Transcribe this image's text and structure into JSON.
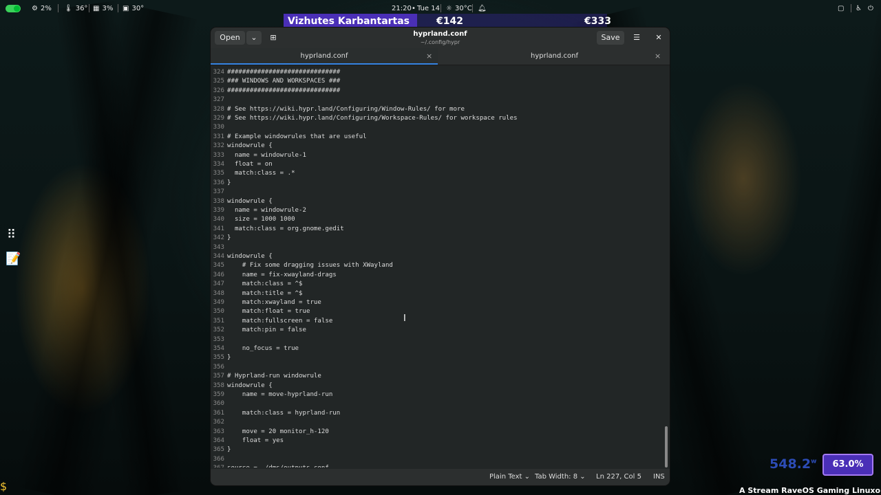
{
  "topbar": {
    "cpu": "2%",
    "temp1": "36°",
    "ram": "3%",
    "temp2": "30°",
    "time": "21:20",
    "date": "Tue 14",
    "weather": "30°C"
  },
  "hud": {
    "name": "Vizhutes Karbantartas",
    "value1": "€142",
    "value2": "€333"
  },
  "editor_window": {
    "open_label": "Open",
    "save_label": "Save",
    "title": "hyprland.conf",
    "subtitle": "~/.config/hypr",
    "tabs": [
      {
        "label": "hyprland.conf"
      },
      {
        "label": "hyprland.conf"
      }
    ],
    "lines": [
      {
        "n": "324",
        "t": "##############################"
      },
      {
        "n": "325",
        "t": "### WINDOWS AND WORKSPACES ###"
      },
      {
        "n": "326",
        "t": "##############################"
      },
      {
        "n": "327",
        "t": ""
      },
      {
        "n": "328",
        "t": "# See https://wiki.hypr.land/Configuring/Window-Rules/ for more"
      },
      {
        "n": "329",
        "t": "# See https://wiki.hypr.land/Configuring/Workspace-Rules/ for workspace rules"
      },
      {
        "n": "330",
        "t": ""
      },
      {
        "n": "331",
        "t": "# Example windowrules that are useful"
      },
      {
        "n": "332",
        "t": "windowrule {"
      },
      {
        "n": "333",
        "t": "  name = windowrule-1"
      },
      {
        "n": "334",
        "t": "  float = on"
      },
      {
        "n": "335",
        "t": "  match:class = .*"
      },
      {
        "n": "336",
        "t": "}"
      },
      {
        "n": "337",
        "t": ""
      },
      {
        "n": "338",
        "t": "windowrule {"
      },
      {
        "n": "339",
        "t": "  name = windowrule-2"
      },
      {
        "n": "340",
        "t": "  size = 1000 1000"
      },
      {
        "n": "341",
        "t": "  match:class = org.gnome.gedit"
      },
      {
        "n": "342",
        "t": "}"
      },
      {
        "n": "343",
        "t": ""
      },
      {
        "n": "344",
        "t": "windowrule {"
      },
      {
        "n": "345",
        "t": "    # Fix some dragging issues with XWayland"
      },
      {
        "n": "346",
        "t": "    name = fix-xwayland-drags"
      },
      {
        "n": "347",
        "t": "    match:class = ^$"
      },
      {
        "n": "348",
        "t": "    match:title = ^$"
      },
      {
        "n": "349",
        "t": "    match:xwayland = true"
      },
      {
        "n": "350",
        "t": "    match:float = true"
      },
      {
        "n": "351",
        "t": "    match:fullscreen = false"
      },
      {
        "n": "352",
        "t": "    match:pin = false"
      },
      {
        "n": "353",
        "t": ""
      },
      {
        "n": "354",
        "t": "    no_focus = true"
      },
      {
        "n": "355",
        "t": "}"
      },
      {
        "n": "356",
        "t": ""
      },
      {
        "n": "357",
        "t": "# Hyprland-run windowrule"
      },
      {
        "n": "358",
        "t": "windowrule {"
      },
      {
        "n": "359",
        "t": "    name = move-hyprland-run"
      },
      {
        "n": "360",
        "t": ""
      },
      {
        "n": "361",
        "t": "    match:class = hyprland-run"
      },
      {
        "n": "362",
        "t": ""
      },
      {
        "n": "363",
        "t": "    move = 20 monitor_h-120"
      },
      {
        "n": "364",
        "t": "    float = yes"
      },
      {
        "n": "365",
        "t": "}"
      },
      {
        "n": "366",
        "t": ""
      },
      {
        "n": "367",
        "t": "source = ./dms/outputs.conf"
      }
    ],
    "status": {
      "language": "Plain Text",
      "tab_width": "Tab Width: 8",
      "position": "Ln 227, Col 5",
      "mode": "INS"
    }
  },
  "overlay": {
    "power": "548.2",
    "power_unit": "w",
    "percent": "63.0%",
    "ticker": "A Stream RaveOS Gaming Linuxon fut"
  }
}
